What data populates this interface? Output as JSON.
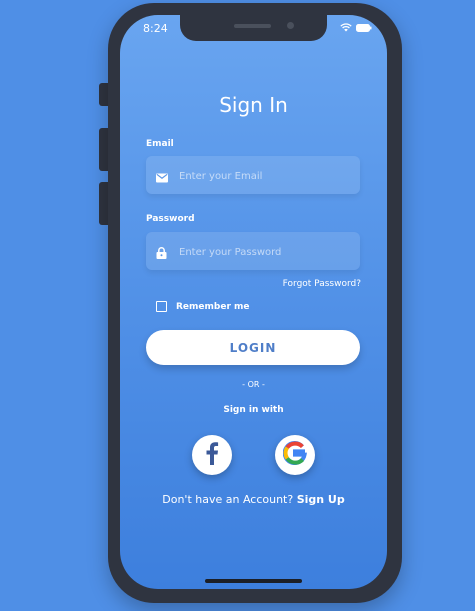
{
  "status_bar": {
    "time": "8:24"
  },
  "page": {
    "title": "Sign In"
  },
  "email": {
    "label": "Email",
    "placeholder": "Enter your Email"
  },
  "password": {
    "label": "Password",
    "placeholder": "Enter your Password"
  },
  "forgot_password": "Forgot Password?",
  "remember_me": {
    "label": "Remember me",
    "checked": false
  },
  "login_button": "LOGIN",
  "divider": "- OR -",
  "social": {
    "heading": "Sign in with",
    "providers": [
      "facebook",
      "google"
    ]
  },
  "signup": {
    "prompt": "Don't have an Account?",
    "link": "Sign Up"
  },
  "icons": [
    "wifi-icon",
    "battery-icon",
    "mail-icon",
    "lock-icon",
    "facebook-icon",
    "google-icon"
  ],
  "colors": {
    "background": "#4f8fe6",
    "frame": "#2f3440",
    "button_text": "#4f7ec8",
    "facebook": "#3b5998"
  }
}
